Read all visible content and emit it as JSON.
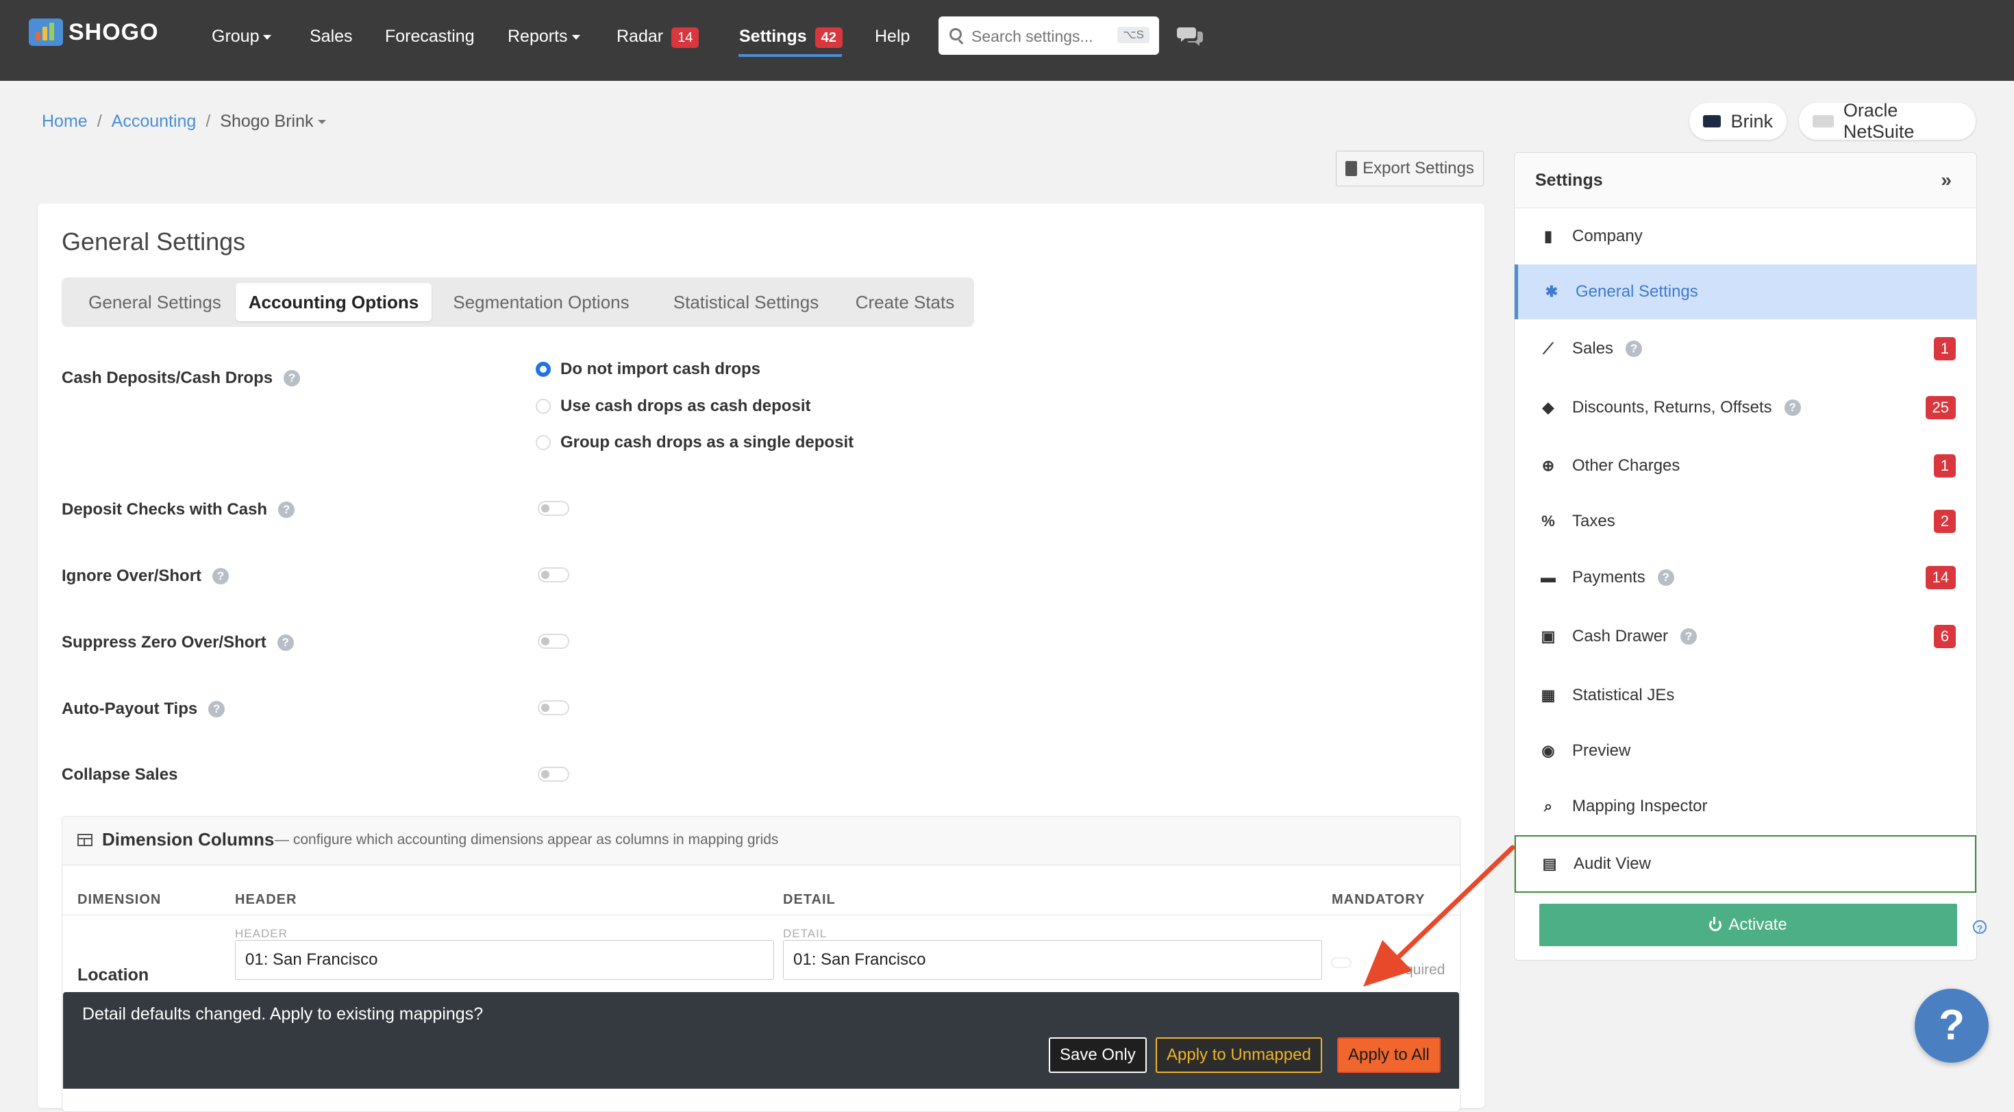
{
  "app": {
    "logo_text": "SHOGO"
  },
  "nav": {
    "group": "Group",
    "sales": "Sales",
    "forecasting": "Forecasting",
    "reports": "Reports",
    "radar": "Radar",
    "radar_count": "14",
    "settings": "Settings",
    "settings_count": "42",
    "help": "Help"
  },
  "search": {
    "placeholder": "Search settings...",
    "shortcut": "⌥S"
  },
  "breadcrumb": {
    "home": "Home",
    "accounting": "Accounting",
    "current": "Shogo Brink"
  },
  "integrations": {
    "pos": "Brink",
    "erp": "Oracle NetSuite"
  },
  "export_label": "Export Settings",
  "card": {
    "title": "General Settings",
    "tabs": [
      "General Settings",
      "Accounting Options",
      "Segmentation Options",
      "Statistical Settings",
      "Create Stats"
    ],
    "active_tab": "Accounting Options"
  },
  "options": {
    "cash_deposits_label": "Cash Deposits/Cash Drops",
    "cash_options": [
      "Do not import cash drops",
      "Use cash drops as cash deposit",
      "Group cash drops as a single deposit"
    ],
    "cash_selected": "Do not import cash drops",
    "deposit_checks": "Deposit Checks with Cash",
    "ignore_over_short": "Ignore Over/Short",
    "suppress_zero": "Suppress Zero Over/Short",
    "auto_payout": "Auto-Payout Tips",
    "collapse_sales": "Collapse Sales"
  },
  "dimensions": {
    "title": "Dimension Columns",
    "description": "— configure which accounting dimensions appear as columns in mapping grids",
    "col_dimension": "DIMENSION",
    "col_header": "HEADER",
    "col_detail": "DETAIL",
    "col_mandatory": "MANDATORY",
    "sub_header": "HEADER",
    "sub_detail": "DETAIL",
    "row_label": "Location",
    "header_value": "01: San Francisco",
    "detail_value": "01: San Francisco",
    "mandatory_text": "quired"
  },
  "toast": {
    "message": "Detail defaults changed. Apply to existing mappings?",
    "save_only": "Save Only",
    "apply_unmapped": "Apply to Unmapped",
    "apply_all": "Apply to All"
  },
  "sidebar": {
    "title": "Settings",
    "collapse": "»",
    "items": [
      {
        "label": "Company",
        "icon": "building-icon",
        "count": ""
      },
      {
        "label": "General Settings",
        "icon": "gear-icon",
        "count": ""
      },
      {
        "label": "Sales",
        "icon": "line-chart-icon",
        "count": "1"
      },
      {
        "label": "Discounts, Returns, Offsets",
        "icon": "tags-icon",
        "count": "25"
      },
      {
        "label": "Other Charges",
        "icon": "plus-circle-icon",
        "count": "1"
      },
      {
        "label": "Taxes",
        "icon": "percent-icon",
        "count": "2"
      },
      {
        "label": "Payments",
        "icon": "credit-card-icon",
        "count": "14"
      },
      {
        "label": "Cash Drawer",
        "icon": "cash-register-icon",
        "count": "6"
      },
      {
        "label": "Statistical JEs",
        "icon": "calculator-icon",
        "count": ""
      },
      {
        "label": "Preview",
        "icon": "eye-icon",
        "count": ""
      },
      {
        "label": "Mapping Inspector",
        "icon": "search-icon",
        "count": ""
      },
      {
        "label": "Audit View",
        "icon": "clipboard-check-icon",
        "count": ""
      }
    ],
    "activate": "Activate"
  },
  "help_fab": "?",
  "colors": {
    "accent": "#4a8fd6",
    "badge": "#d9363e",
    "activate": "#4caf85",
    "toast": "#343a40",
    "annotation_arrow": "#e8492a"
  }
}
